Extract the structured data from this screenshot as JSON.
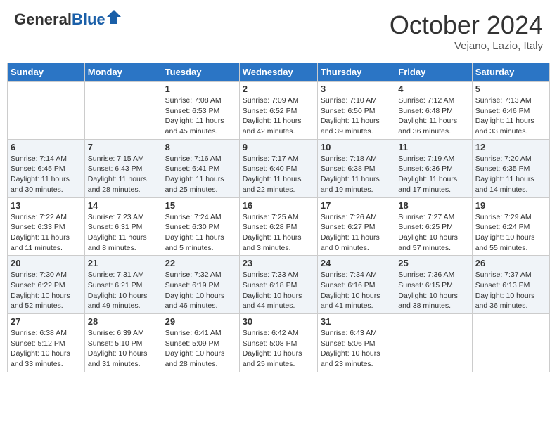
{
  "header": {
    "logo_general": "General",
    "logo_blue": "Blue",
    "month_title": "October 2024",
    "location": "Vejano, Lazio, Italy"
  },
  "weekdays": [
    "Sunday",
    "Monday",
    "Tuesday",
    "Wednesday",
    "Thursday",
    "Friday",
    "Saturday"
  ],
  "weeks": [
    [
      {
        "day": "",
        "info": ""
      },
      {
        "day": "",
        "info": ""
      },
      {
        "day": "1",
        "info": "Sunrise: 7:08 AM\nSunset: 6:53 PM\nDaylight: 11 hours and 45 minutes."
      },
      {
        "day": "2",
        "info": "Sunrise: 7:09 AM\nSunset: 6:52 PM\nDaylight: 11 hours and 42 minutes."
      },
      {
        "day": "3",
        "info": "Sunrise: 7:10 AM\nSunset: 6:50 PM\nDaylight: 11 hours and 39 minutes."
      },
      {
        "day": "4",
        "info": "Sunrise: 7:12 AM\nSunset: 6:48 PM\nDaylight: 11 hours and 36 minutes."
      },
      {
        "day": "5",
        "info": "Sunrise: 7:13 AM\nSunset: 6:46 PM\nDaylight: 11 hours and 33 minutes."
      }
    ],
    [
      {
        "day": "6",
        "info": "Sunrise: 7:14 AM\nSunset: 6:45 PM\nDaylight: 11 hours and 30 minutes."
      },
      {
        "day": "7",
        "info": "Sunrise: 7:15 AM\nSunset: 6:43 PM\nDaylight: 11 hours and 28 minutes."
      },
      {
        "day": "8",
        "info": "Sunrise: 7:16 AM\nSunset: 6:41 PM\nDaylight: 11 hours and 25 minutes."
      },
      {
        "day": "9",
        "info": "Sunrise: 7:17 AM\nSunset: 6:40 PM\nDaylight: 11 hours and 22 minutes."
      },
      {
        "day": "10",
        "info": "Sunrise: 7:18 AM\nSunset: 6:38 PM\nDaylight: 11 hours and 19 minutes."
      },
      {
        "day": "11",
        "info": "Sunrise: 7:19 AM\nSunset: 6:36 PM\nDaylight: 11 hours and 17 minutes."
      },
      {
        "day": "12",
        "info": "Sunrise: 7:20 AM\nSunset: 6:35 PM\nDaylight: 11 hours and 14 minutes."
      }
    ],
    [
      {
        "day": "13",
        "info": "Sunrise: 7:22 AM\nSunset: 6:33 PM\nDaylight: 11 hours and 11 minutes."
      },
      {
        "day": "14",
        "info": "Sunrise: 7:23 AM\nSunset: 6:31 PM\nDaylight: 11 hours and 8 minutes."
      },
      {
        "day": "15",
        "info": "Sunrise: 7:24 AM\nSunset: 6:30 PM\nDaylight: 11 hours and 5 minutes."
      },
      {
        "day": "16",
        "info": "Sunrise: 7:25 AM\nSunset: 6:28 PM\nDaylight: 11 hours and 3 minutes."
      },
      {
        "day": "17",
        "info": "Sunrise: 7:26 AM\nSunset: 6:27 PM\nDaylight: 11 hours and 0 minutes."
      },
      {
        "day": "18",
        "info": "Sunrise: 7:27 AM\nSunset: 6:25 PM\nDaylight: 10 hours and 57 minutes."
      },
      {
        "day": "19",
        "info": "Sunrise: 7:29 AM\nSunset: 6:24 PM\nDaylight: 10 hours and 55 minutes."
      }
    ],
    [
      {
        "day": "20",
        "info": "Sunrise: 7:30 AM\nSunset: 6:22 PM\nDaylight: 10 hours and 52 minutes."
      },
      {
        "day": "21",
        "info": "Sunrise: 7:31 AM\nSunset: 6:21 PM\nDaylight: 10 hours and 49 minutes."
      },
      {
        "day": "22",
        "info": "Sunrise: 7:32 AM\nSunset: 6:19 PM\nDaylight: 10 hours and 46 minutes."
      },
      {
        "day": "23",
        "info": "Sunrise: 7:33 AM\nSunset: 6:18 PM\nDaylight: 10 hours and 44 minutes."
      },
      {
        "day": "24",
        "info": "Sunrise: 7:34 AM\nSunset: 6:16 PM\nDaylight: 10 hours and 41 minutes."
      },
      {
        "day": "25",
        "info": "Sunrise: 7:36 AM\nSunset: 6:15 PM\nDaylight: 10 hours and 38 minutes."
      },
      {
        "day": "26",
        "info": "Sunrise: 7:37 AM\nSunset: 6:13 PM\nDaylight: 10 hours and 36 minutes."
      }
    ],
    [
      {
        "day": "27",
        "info": "Sunrise: 6:38 AM\nSunset: 5:12 PM\nDaylight: 10 hours and 33 minutes."
      },
      {
        "day": "28",
        "info": "Sunrise: 6:39 AM\nSunset: 5:10 PM\nDaylight: 10 hours and 31 minutes."
      },
      {
        "day": "29",
        "info": "Sunrise: 6:41 AM\nSunset: 5:09 PM\nDaylight: 10 hours and 28 minutes."
      },
      {
        "day": "30",
        "info": "Sunrise: 6:42 AM\nSunset: 5:08 PM\nDaylight: 10 hours and 25 minutes."
      },
      {
        "day": "31",
        "info": "Sunrise: 6:43 AM\nSunset: 5:06 PM\nDaylight: 10 hours and 23 minutes."
      },
      {
        "day": "",
        "info": ""
      },
      {
        "day": "",
        "info": ""
      }
    ]
  ]
}
